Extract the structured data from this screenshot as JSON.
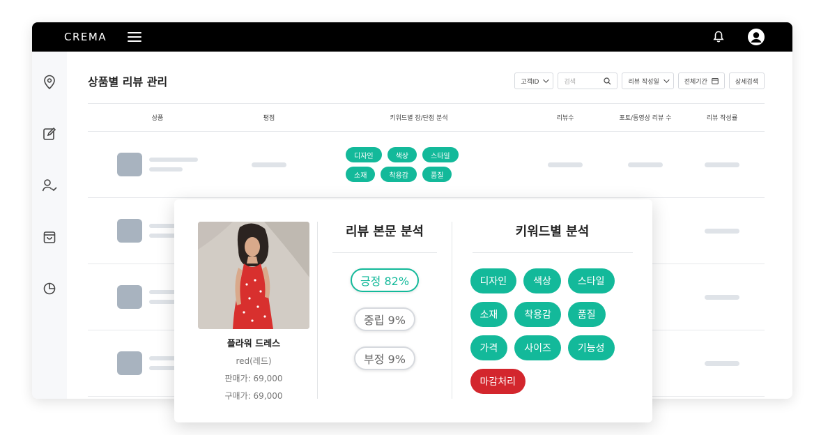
{
  "app": {
    "logo": "CREMA"
  },
  "page": {
    "title": "상품별 리뷰 관리"
  },
  "filters": {
    "customer_select": "고객ID",
    "search_placeholder": "검색",
    "date_type_select": "리뷰 작성일",
    "period_button": "전체기간",
    "advanced_search": "상세검색"
  },
  "table": {
    "headers": [
      "상품",
      "평점",
      "키워드별 장/단점 분석",
      "리뷰수",
      "포토/동영상 리뷰 수",
      "리뷰 작성률"
    ],
    "row1_keywords": [
      "디자인",
      "색상",
      "스타일",
      "소재",
      "착용감",
      "품질"
    ]
  },
  "card": {
    "product": {
      "name": "플라워 드레스",
      "option": "red(레드)",
      "sale_price": "판매가: 69,000",
      "purchase_price": "구매가: 69,000"
    },
    "review_analysis": {
      "title": "리뷰 본문 분석",
      "positive": "긍정 82%",
      "neutral": "중립 9%",
      "negative": "부정 9%"
    },
    "keyword_analysis": {
      "title": "키워드별 분석",
      "keywords": [
        "디자인",
        "색상",
        "스타일",
        "소재",
        "착용감",
        "품질",
        "가격",
        "사이즈",
        "기능성"
      ],
      "alert_keyword": "마감처리"
    }
  },
  "colors": {
    "accent": "#13b99a",
    "alert": "#d3262d",
    "topbar": "#000000"
  },
  "icons": [
    "bell-icon",
    "user-avatar-icon",
    "location-icon",
    "edit-icon",
    "user-check-icon",
    "shopping-bag-icon",
    "pie-chart-icon",
    "search-icon",
    "calendar-icon"
  ]
}
